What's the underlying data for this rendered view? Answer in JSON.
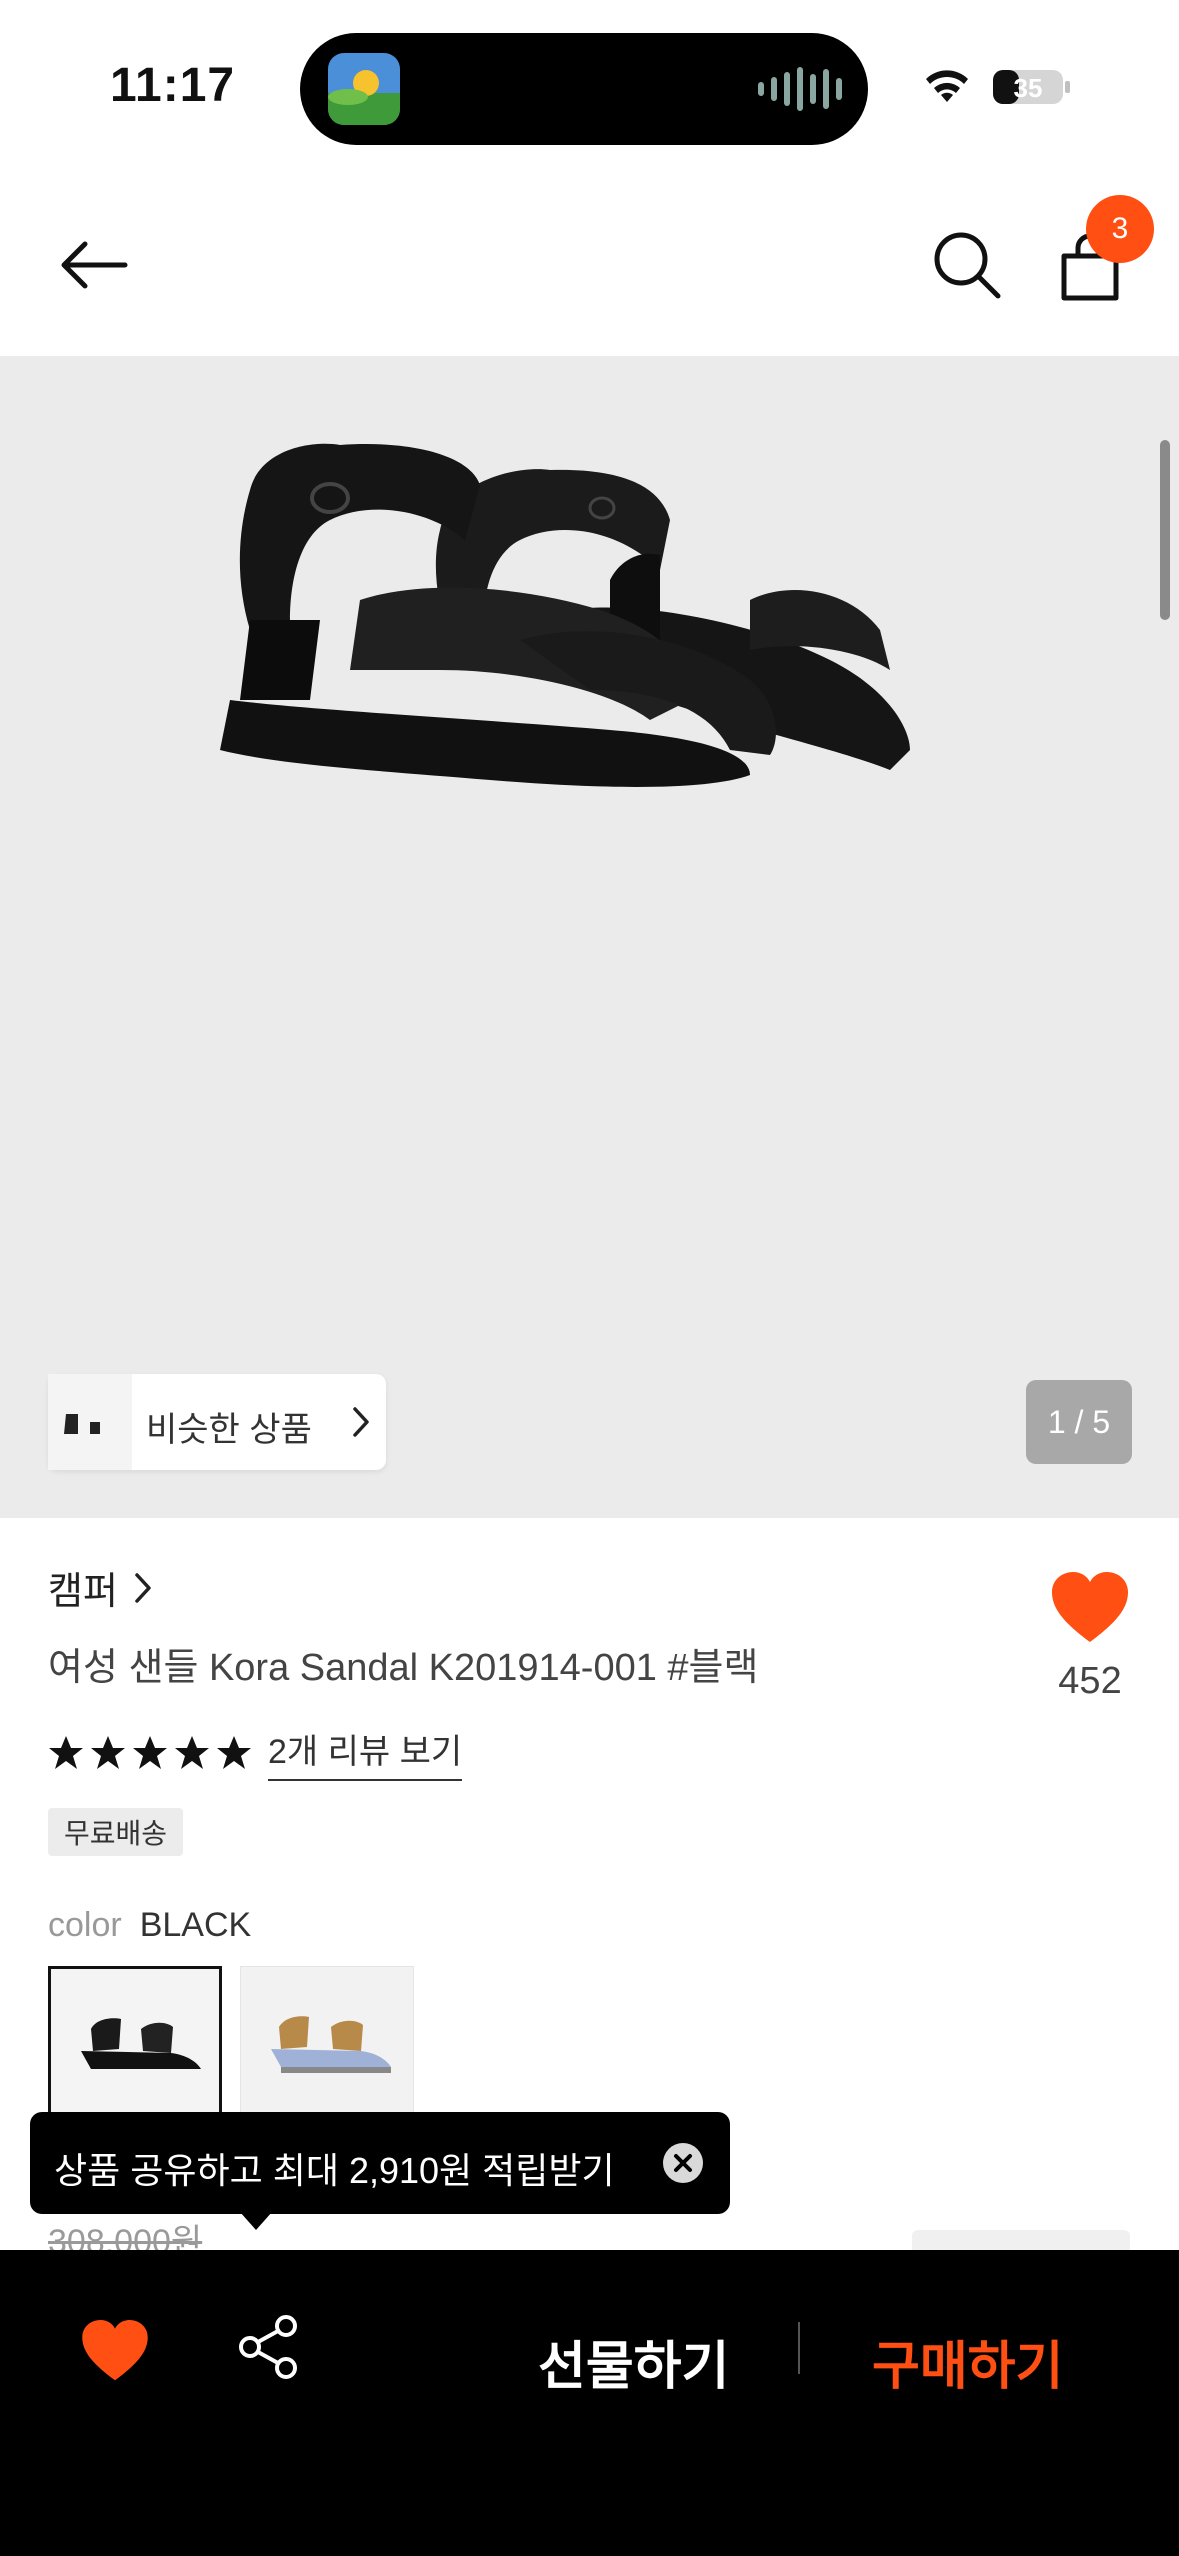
{
  "status_bar": {
    "time": "11:17",
    "battery": "35"
  },
  "header": {
    "cart_count": "3"
  },
  "gallery": {
    "similar_label": "비슷한 상품",
    "page_counter": "1 / 5"
  },
  "product": {
    "brand": "캠퍼",
    "title": "여성 샌들 Kora Sandal K201914-001 #블랙",
    "like_count": "452",
    "rating_stars": 5,
    "review_link": "2개 리뷰 보기",
    "shipping_badge": "무료배송",
    "color_label": "color",
    "color_value": "BLACK",
    "old_price": "308,000원"
  },
  "tooltip": {
    "text": "상품 공유하고 최대 2,910원 적립받기"
  },
  "bottom_bar": {
    "gift_label": "선물하기",
    "buy_label": "구매하기"
  },
  "colors": {
    "accent": "#ff4f12",
    "gallery_bg": "#ebebeb",
    "bottom_bar_bg": "#000000"
  },
  "icons": {
    "back": "arrow-left-icon",
    "search": "search-icon",
    "cart": "shopping-bag-icon",
    "like": "heart-icon",
    "share": "share-icon",
    "close": "close-icon",
    "star": "star-icon",
    "chevron": "chevron-right-icon"
  }
}
